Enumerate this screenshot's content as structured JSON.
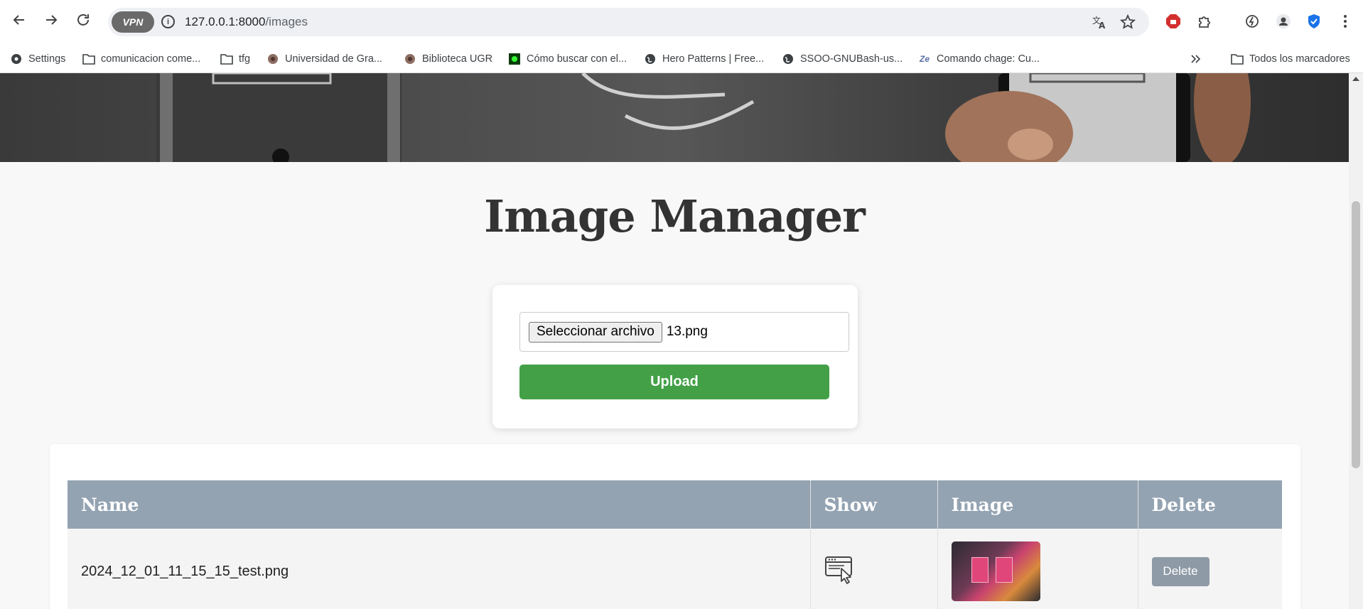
{
  "browser": {
    "vpn_label": "VPN",
    "url_host": "127.0.0.1:8000",
    "url_path": "/images",
    "bookmarks": [
      {
        "label": "Settings",
        "icon": "gear-icon"
      },
      {
        "label": "comunicacion come...",
        "icon": "folder-icon"
      },
      {
        "label": "tfg",
        "icon": "folder-icon"
      },
      {
        "label": "Universidad de Gra...",
        "icon": "crest-icon"
      },
      {
        "label": "Biblioteca UGR",
        "icon": "crest-icon"
      },
      {
        "label": "Cómo buscar con el...",
        "icon": "green-square-icon"
      },
      {
        "label": "Hero Patterns | Free...",
        "icon": "globe-icon"
      },
      {
        "label": "SSOO-GNUBash-us...",
        "icon": "globe-icon"
      },
      {
        "label": "Comando chage: Cu...",
        "icon": "ze-icon"
      }
    ],
    "all_bookmarks_label": "Todos los marcadores"
  },
  "page": {
    "title": "Image Manager",
    "upload": {
      "choose_file_label": "Seleccionar archivo",
      "file_name": "13.png",
      "upload_label": "Upload",
      "accent_color": "#43a047"
    },
    "table": {
      "headers": [
        "Name",
        "Show",
        "Image",
        "Delete"
      ],
      "header_color": "#94a3b2",
      "rows": [
        {
          "name": "2024_12_01_11_15_15_test.png",
          "show_icon": "window-cursor-icon",
          "delete_label": "Delete"
        }
      ]
    }
  }
}
